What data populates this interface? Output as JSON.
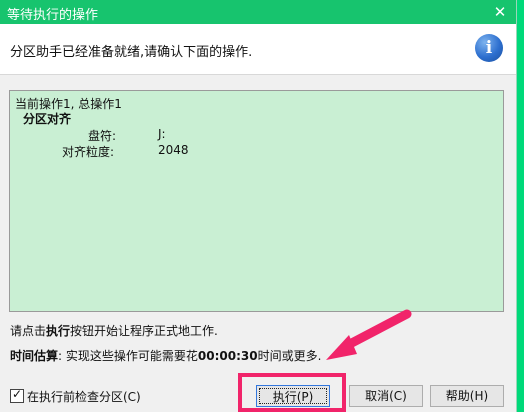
{
  "window": {
    "title": "等待执行的操作",
    "close_glyph": "✕"
  },
  "header": {
    "text": "分区助手已经准备就绪,请确认下面的操作.",
    "info_glyph": "i"
  },
  "log": {
    "line1": "当前操作1, 总操作1",
    "operation": "分区对齐",
    "details": [
      {
        "key": "盘符:",
        "value": "J:"
      },
      {
        "key": "对齐粒度:",
        "value": "2048"
      }
    ]
  },
  "message1": {
    "prefix": "请点击",
    "bold": "执行",
    "suffix": "按钮开始让程序正式地工作."
  },
  "message2": {
    "label": "时间估算",
    "text1": ": 实现这些操作可能需要花",
    "time": "00:00:30",
    "text2": "时间或更多."
  },
  "checkbox": {
    "label": "在执行前检查分区(C)",
    "checked": true
  },
  "buttons": {
    "execute": "执行(P)",
    "cancel": "取消(C)",
    "help": "帮助(H)"
  },
  "annotation": {
    "highlight_color": "#f1246a"
  }
}
